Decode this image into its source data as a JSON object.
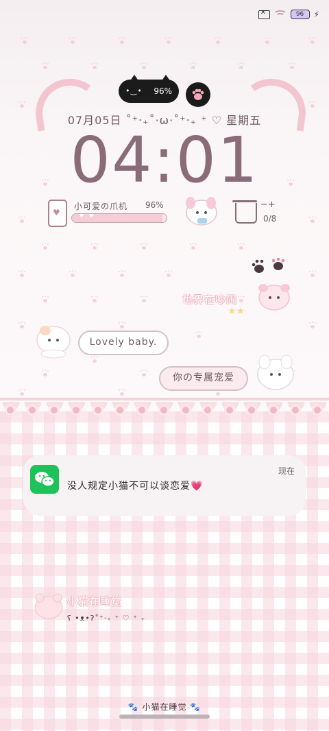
{
  "status_bar": {
    "battery_level": "96",
    "sim": "no-sim-icon",
    "wifi": "wifi-icon",
    "charging": "bolt-icon"
  },
  "island": {
    "eyes": "•‿•",
    "battery": "96%"
  },
  "date": {
    "text": "07月05日 ˚⁺‧₊˚·ω·˚⁺‧₊ ⁺ ♡ 星期五"
  },
  "clock": {
    "time": "04:01"
  },
  "battery_widget": {
    "title": "小可爱の爪机",
    "percent": "96%",
    "level": 0.96
  },
  "water_widget": {
    "count": "0/8",
    "controls": "−+"
  },
  "stickers": {
    "world_noisy": "世界在吵闹",
    "lovely": "Lovely baby.",
    "exclusive": "你の专属宠爱"
  },
  "notification": {
    "app": "WeChat",
    "text": "没人规定小猫不可以谈恋爱💗",
    "time": "现在"
  },
  "sleep_widget": {
    "title": "小猫在睡觉",
    "kaomoji": "ʕ •ᴥ•ʔ˚⁺‧₊ ⁺ ♡ ⁺ ₊"
  },
  "bottom": {
    "label": "小猫在睡觉"
  },
  "colors": {
    "accent_pink": "#f3c6cf",
    "clock_color": "#8a6c78",
    "wechat_green": "#1fc25a"
  }
}
